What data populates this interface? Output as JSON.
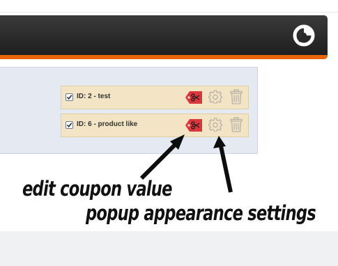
{
  "header": {
    "logo_icon": "wheel-logo-icon",
    "accent_color": "#e8650a",
    "background_color": "#2a2a2a"
  },
  "coupons": [
    {
      "label": "ID: 2 - test",
      "checked": true
    },
    {
      "label": "ID: 6 - product like",
      "checked": true
    }
  ],
  "row_icons": {
    "edit": "coupon-tag-scissors-icon",
    "settings": "gear-icon",
    "delete": "trash-icon"
  },
  "annotations": {
    "edit_value": "edit coupon value",
    "popup_settings": "popup appearance settings"
  },
  "colors": {
    "panel": "#e4e9f2",
    "row": "#f2e4c4",
    "tag": "#d9363e"
  }
}
